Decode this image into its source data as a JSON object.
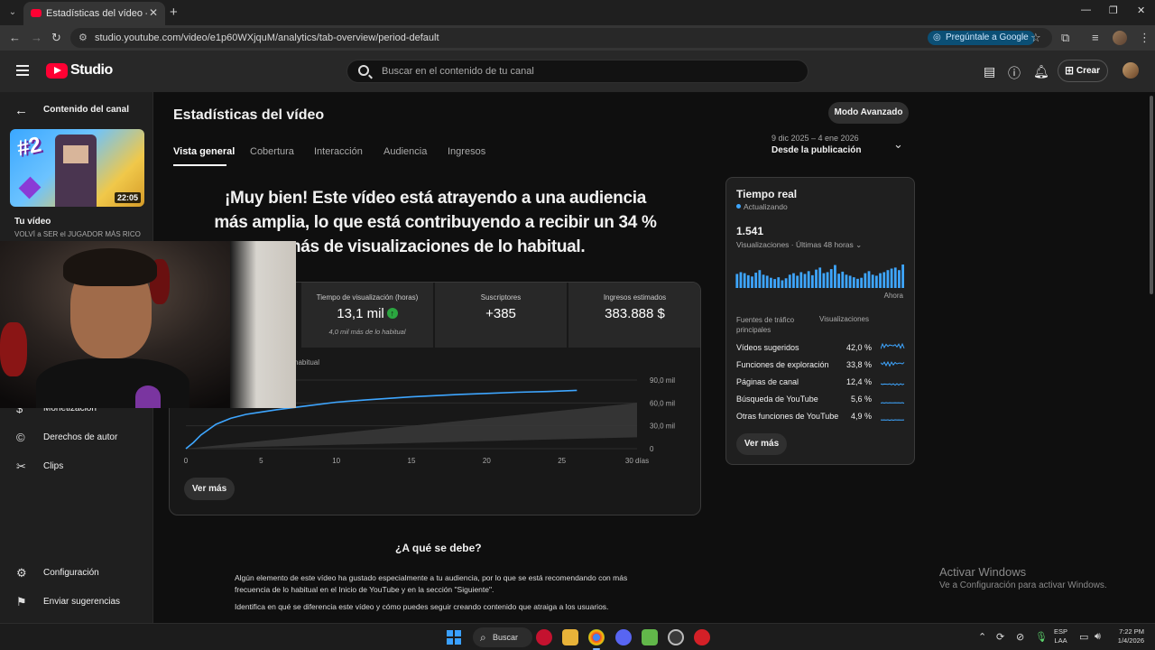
{
  "browser": {
    "tab_title": "Estadísticas del vídeo - YouTube",
    "url": "studio.youtube.com/video/e1p60WXjquM/analytics/tab-overview/period-default",
    "ask_google": "Pregúntale a Google"
  },
  "header": {
    "logo_text": "Studio",
    "search_placeholder": "Buscar en el contenido de tu canal",
    "create_label": "Crear"
  },
  "sidebar": {
    "back_label": "Contenido del canal",
    "thumb_duration": "22:05",
    "your_video": "Tu vídeo",
    "video_title": "VOLVÍ a SER el JUGADOR MÁS RICO...",
    "items": [
      {
        "label": "Monetización",
        "icon": "dollar-circle-icon"
      },
      {
        "label": "Derechos de autor",
        "icon": "copyright-icon"
      },
      {
        "label": "Clips",
        "icon": "scissors-icon"
      }
    ],
    "bottom_items": [
      {
        "label": "Configuración",
        "icon": "gear-icon"
      },
      {
        "label": "Enviar sugerencias",
        "icon": "feedback-icon"
      }
    ]
  },
  "main": {
    "title": "Estadísticas del vídeo",
    "advanced_mode": "Modo Avanzado",
    "tabs": [
      "Vista general",
      "Cobertura",
      "Interacción",
      "Audiencia",
      "Ingresos"
    ],
    "period_range": "9 dic 2025 – 4 ene 2026",
    "period_label": "Desde la publicación",
    "headline": "¡Muy bien! Este vídeo está atrayendo a una audiencia más amplia, lo que está contribuyendo a recibir un 34 % más de visualizaciones de lo habitual.",
    "metrics": [
      {
        "label": "Tiempo de visualización (horas)",
        "value": "13,1 mil",
        "note": "4,0 mil más de lo habitual"
      },
      {
        "label": "Suscriptores",
        "value": "+385"
      },
      {
        "label": "Ingresos estimados",
        "value": "383.888 $"
      }
    ],
    "legend_note": "habitual",
    "ver_mas": "Ver más",
    "why_title": "¿A qué se debe?",
    "why_p1": "Algún elemento de este vídeo ha gustado especialmente a tu audiencia, por lo que se está recomendando con más frecuencia de lo habitual en el Inicio de YouTube y en la sección \"Siguiente\".",
    "why_p2": "Identifica en qué se diferencia este vídeo y cómo puedes seguir creando contenido que atraiga a los usuarios."
  },
  "chart_data": {
    "type": "line",
    "x_ticks": [
      "0",
      "5",
      "10",
      "15",
      "20",
      "25",
      "30 días"
    ],
    "y_ticks": [
      "0",
      "30,0 mil",
      "60,0 mil",
      "90,0 mil"
    ],
    "ylim": [
      0,
      90000
    ],
    "xlim": [
      0,
      30
    ],
    "series": [
      {
        "x": [
          0,
          0.5,
          1,
          2,
          3,
          4,
          5,
          6,
          8,
          10,
          12,
          15,
          18,
          20,
          22,
          24,
          26
        ],
        "values": [
          0,
          8000,
          18000,
          32000,
          40000,
          45000,
          48000,
          51000,
          56000,
          61000,
          64000,
          68000,
          71000,
          72500,
          74000,
          75000,
          76500
        ]
      }
    ],
    "band": {
      "x": [
        0,
        30
      ],
      "low": [
        0,
        15000
      ],
      "high": [
        0,
        60000
      ]
    }
  },
  "realtime": {
    "title": "Tiempo real",
    "status": "Actualizando",
    "count": "1.541",
    "subtitle": "Visualizaciones · Últimas 48 horas",
    "now_label": "Ahora",
    "bars": [
      55,
      62,
      58,
      50,
      45,
      60,
      70,
      52,
      48,
      40,
      35,
      42,
      30,
      38,
      52,
      58,
      48,
      62,
      55,
      66,
      50,
      72,
      80,
      58,
      62,
      74,
      90,
      56,
      64,
      52,
      48,
      42,
      36,
      40,
      58,
      66,
      52,
      48,
      58,
      62,
      70,
      76,
      80,
      70,
      92
    ],
    "sources_header": "Fuentes de tráfico principales",
    "views_header": "Visualizaciones",
    "sources": [
      {
        "name": "Vídeos sugeridos",
        "pct": "42,0 %"
      },
      {
        "name": "Funciones de exploración",
        "pct": "33,8 %"
      },
      {
        "name": "Páginas de canal",
        "pct": "12,4 %"
      },
      {
        "name": "Búsqueda de YouTube",
        "pct": "5,6 %"
      },
      {
        "name": "Otras funciones de YouTube",
        "pct": "4,9 %"
      }
    ],
    "ver_mas": "Ver más"
  },
  "windows": {
    "activate_title": "Activar Windows",
    "activate_sub": "Ve a Configuración para activar Windows.",
    "search": "Buscar",
    "lang1": "ESP",
    "lang2": "LAA",
    "time": "7:22 PM",
    "date": "1/4/2026"
  },
  "colors": {
    "accent_line": "#3ea6ff",
    "yt_red": "#ff0033",
    "up_green": "#2ba640"
  }
}
